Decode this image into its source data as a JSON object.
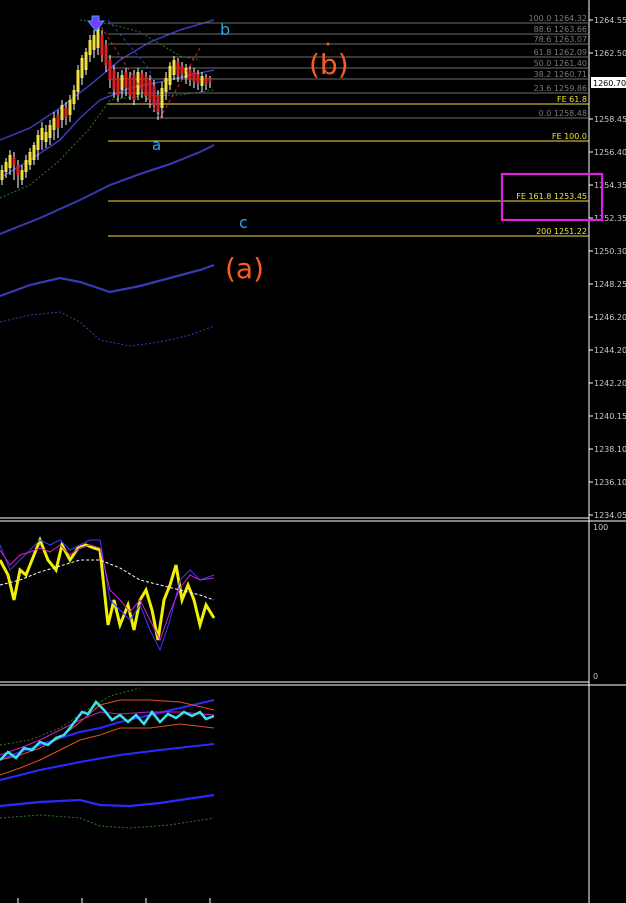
{
  "chart_data": {
    "type": "candlestick",
    "instrument_price_label": "1260.70",
    "y_axis": {
      "ticks": [
        "1264.55",
        "1262.50",
        "1260.70",
        "1258.45",
        "1256.40",
        "1254.35",
        "1252.35",
        "1250.30",
        "1248.25",
        "1246.20",
        "1244.20",
        "1242.20",
        "1240.15",
        "1238.10",
        "1236.10",
        "1234.05"
      ]
    },
    "fib_levels": [
      {
        "label": "100.0 1264.32",
        "color": "#7a7a7a"
      },
      {
        "label": "88.6 1263.66",
        "color": "#7a7a7a"
      },
      {
        "label": "78.6 1263.07",
        "color": "#7a7a7a"
      },
      {
        "label": "61.8 1262.09",
        "color": "#7a7a7a"
      },
      {
        "label": "50.0 1261.40",
        "color": "#7a7a7a"
      },
      {
        "label": "38.2 1260.71",
        "color": "#7a7a7a"
      },
      {
        "label": "23.6 1259.86",
        "color": "#7a7a7a"
      },
      {
        "label": "FE 61.8",
        "color": "#f0e040"
      },
      {
        "label": "0.0 1258.48",
        "color": "#7a7a7a"
      },
      {
        "label": "FE 100.0",
        "color": "#f0e040"
      },
      {
        "label": "FE 161.8 1253.45",
        "color": "#f0e040"
      },
      {
        "label": "200 1251.22",
        "color": "#f0e040"
      }
    ],
    "wave_labels": {
      "b_small": "b",
      "a_small": "a",
      "c_small": "c",
      "b_big": "(b)",
      "a_big": "(a)"
    },
    "colors": {
      "up_candle": "#f0e040",
      "down_candle": "#e02020",
      "fib_line": "#8a8a8a",
      "fe_line": "#f0e040",
      "wave_small": "#29a8e0",
      "wave_big": "#ff5a1e",
      "highlight_box": "#e020e0",
      "band": "#3a3aa8"
    },
    "oscillator1": {
      "labels": [
        "100",
        "0"
      ]
    },
    "oscillator2": {}
  }
}
